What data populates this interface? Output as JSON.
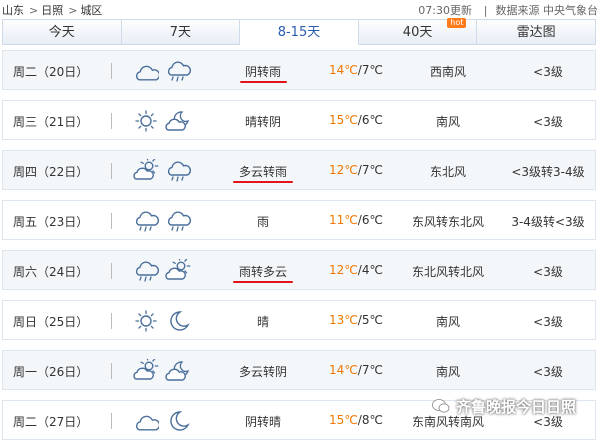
{
  "breadcrumb": {
    "province": "山东",
    "city": "日照",
    "district": "城区",
    "separator": ">"
  },
  "header": {
    "updated": "07:30更新",
    "source_label": "数据来源",
    "source_name": "中央气象台",
    "divider": "|"
  },
  "tabs": [
    {
      "label": "今天"
    },
    {
      "label": "7天"
    },
    {
      "label": "8-15天",
      "active": true
    },
    {
      "label": "40天",
      "badge": "hot"
    },
    {
      "label": "雷达图"
    }
  ],
  "forecast": [
    {
      "day": "周二（20日）",
      "icons": [
        "cloudy-icon",
        "rain-icon"
      ],
      "desc": "阴转雨",
      "temp_hi": "14℃",
      "temp_lo": "/7℃",
      "wind": "西南风",
      "level": "<3级",
      "underlined": true
    },
    {
      "day": "周三（21日）",
      "icons": [
        "sunny-icon",
        "partly-cloudy-night-icon"
      ],
      "desc": "晴转阴",
      "temp_hi": "15℃",
      "temp_lo": "/6℃",
      "wind": "南风",
      "level": "<3级",
      "underlined": false
    },
    {
      "day": "周四（22日）",
      "icons": [
        "partly-cloudy-icon",
        "rain-icon"
      ],
      "desc": "多云转雨",
      "temp_hi": "12℃",
      "temp_lo": "/7℃",
      "wind": "东北风",
      "level": "<3级转3-4级",
      "underlined": true
    },
    {
      "day": "周五（23日）",
      "icons": [
        "rain-icon",
        "rain-icon"
      ],
      "desc": "雨",
      "temp_hi": "11℃",
      "temp_lo": "/6℃",
      "wind": "东风转东北风",
      "level": "3-4级转<3级",
      "underlined": false
    },
    {
      "day": "周六（24日）",
      "icons": [
        "rain-icon",
        "partly-cloudy-icon"
      ],
      "desc": "雨转多云",
      "temp_hi": "12℃",
      "temp_lo": "/4℃",
      "wind": "东北风转北风",
      "level": "<3级",
      "underlined": true
    },
    {
      "day": "周日（25日）",
      "icons": [
        "sunny-icon",
        "moon-icon"
      ],
      "desc": "晴",
      "temp_hi": "13℃",
      "temp_lo": "/5℃",
      "wind": "南风",
      "level": "<3级",
      "underlined": false
    },
    {
      "day": "周一（26日）",
      "icons": [
        "partly-cloudy-icon",
        "partly-cloudy-night-icon"
      ],
      "desc": "多云转阴",
      "temp_hi": "14℃",
      "temp_lo": "/7℃",
      "wind": "南风",
      "level": "<3级",
      "underlined": false
    },
    {
      "day": "周二（27日）",
      "icons": [
        "cloudy-icon",
        "moon-icon"
      ],
      "desc": "阴转晴",
      "temp_hi": "15℃",
      "temp_lo": "/8℃",
      "wind": "东南风转南风",
      "level": "<3级",
      "underlined": false
    }
  ],
  "watermark": {
    "text": "齐鲁晚报今日日照"
  },
  "colors": {
    "accent_temp": "#f07800",
    "underline": "#e3141c",
    "icon_stroke": "#4a6f9a",
    "sun": "#f0a000"
  }
}
